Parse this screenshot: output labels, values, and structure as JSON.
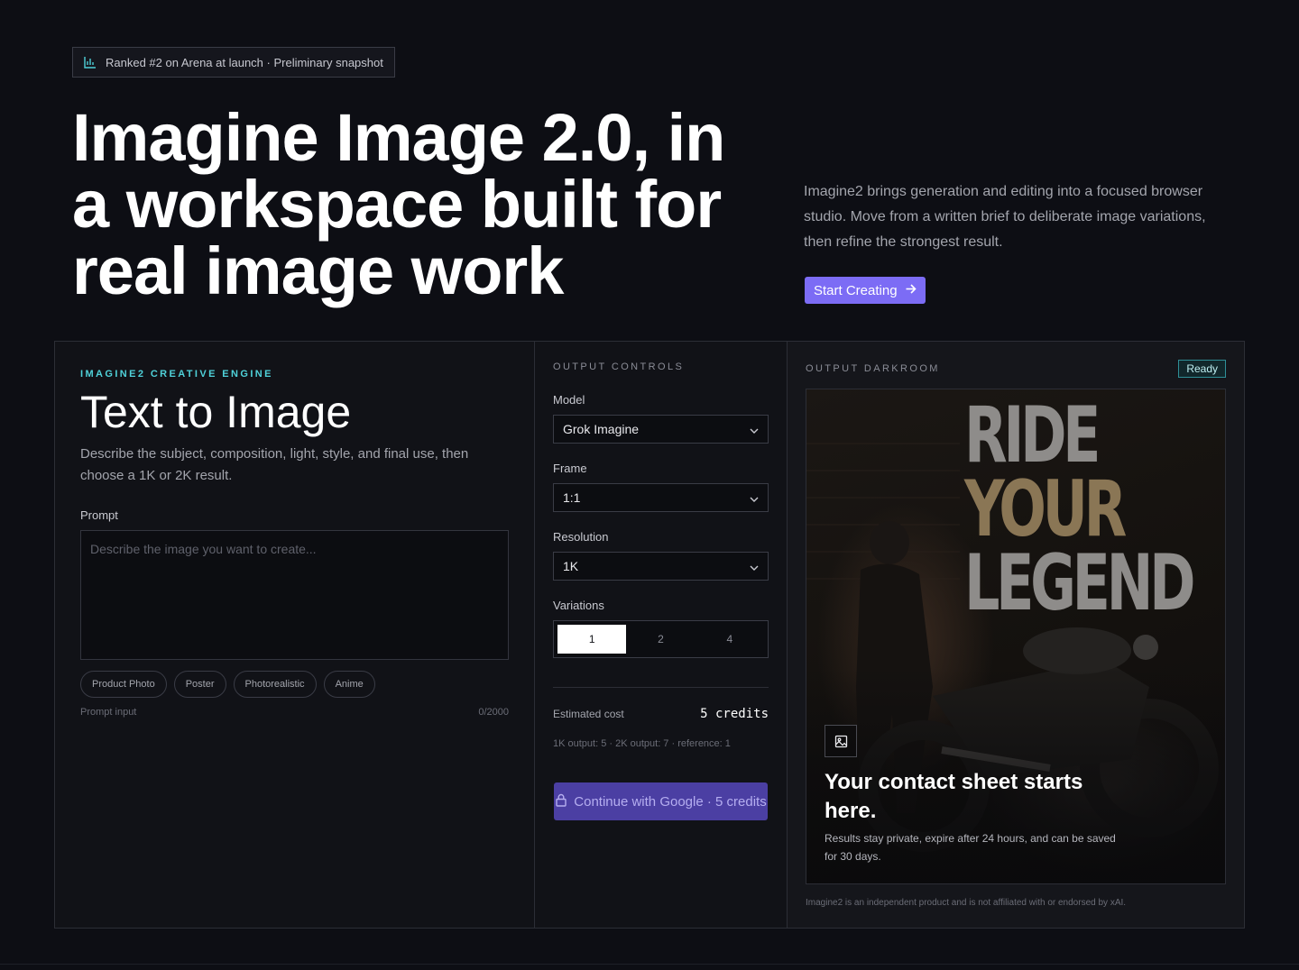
{
  "hero": {
    "badge_text": "Ranked #2 on Arena at launch · Preliminary snapshot",
    "badge_icon": "bar-chart-icon",
    "title": "Imagine Image 2.0, in a workspace built for real image work",
    "description": "Imagine2 brings generation and editing into a focused browser studio. Move from a written brief to deliberate image variations, then refine the strongest result.",
    "cta_label": "Start Creating",
    "accent_color": "#7c6cf5"
  },
  "left": {
    "eyebrow": "IMAGINE2 CREATIVE ENGINE",
    "title": "Text to Image",
    "description": "Describe the subject, composition, light, style, and final use, then choose a 1K or 2K result.",
    "prompt_label": "Prompt",
    "prompt_placeholder": "Describe the image you want to create...",
    "prompt_value": "",
    "chips": [
      "Product Photo",
      "Poster",
      "Photorealistic",
      "Anime"
    ],
    "prompt_hint": "Prompt input",
    "char_count": "0/2000"
  },
  "controls": {
    "eyebrow": "OUTPUT CONTROLS",
    "model_label": "Model",
    "model_value": "Grok Imagine",
    "frame_label": "Frame",
    "frame_value": "1:1",
    "resolution_label": "Resolution",
    "resolution_value": "1K",
    "variations_label": "Variations",
    "variations": [
      "1",
      "2",
      "4"
    ],
    "variations_selected": "1",
    "cost_label": "Estimated cost",
    "cost_value": "5 credits",
    "cost_note": "1K output: 5 · 2K output: 7 · reference: 1",
    "google_button": "Continue with Google · 5 credits"
  },
  "darkroom": {
    "eyebrow": "OUTPUT DARKROOM",
    "status": "Ready",
    "poster_lines": [
      "RIDE",
      "YOUR",
      "LEGEND"
    ],
    "title": "Your contact sheet starts here.",
    "description": "Results stay private, expire after 24 hours, and can be saved for 30 days.",
    "disclaimer": "Imagine2 is an independent product and is not affiliated with or endorsed by xAI.",
    "status_color": "#2f8f97"
  }
}
